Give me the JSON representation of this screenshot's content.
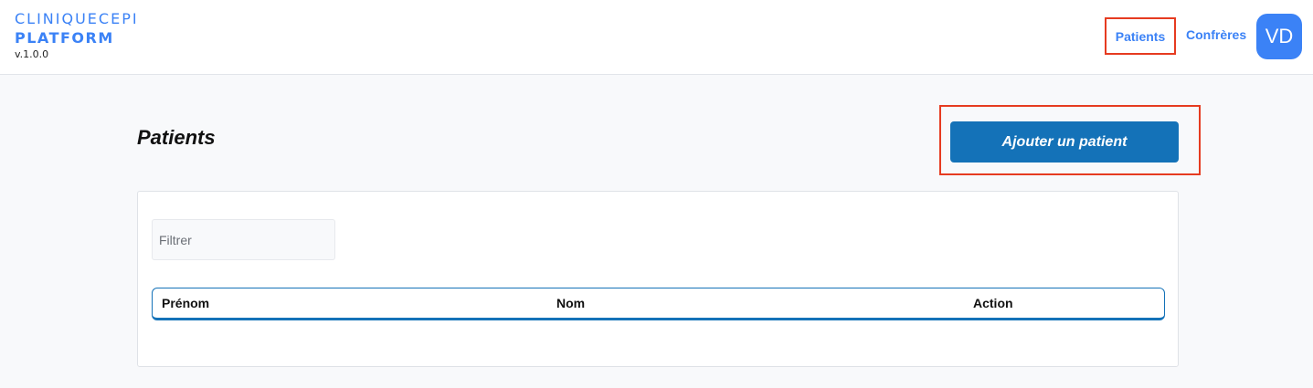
{
  "brand": {
    "line1": "CLINIQUECEPI",
    "line2": "PLATFORM",
    "version": "v.1.0.0"
  },
  "nav": {
    "patients_label": "Patients",
    "confreres_label": "Confrères",
    "avatar_initials": "VD"
  },
  "main": {
    "title": "Patients",
    "add_button_label": "Ajouter un patient",
    "filter": {
      "placeholder": "Filtrer",
      "value": ""
    },
    "table": {
      "columns": [
        "Prénom",
        "Nom",
        "Action"
      ],
      "rows": []
    }
  },
  "colors": {
    "brand": "#3b82f6",
    "button": "#1472b8",
    "highlight": "#e63b20"
  }
}
